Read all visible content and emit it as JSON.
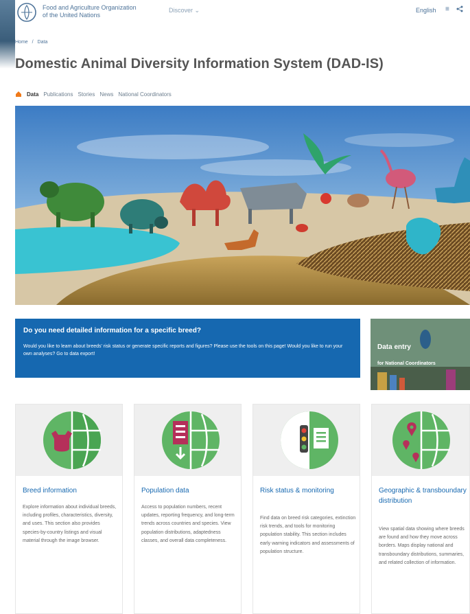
{
  "header": {
    "org_name_line1": "Food and Agriculture Organization",
    "org_name_line2": "of the United Nations",
    "discover_label": "Discover",
    "language_label": "English",
    "icons": [
      "fao-logo",
      "menu-icon",
      "share-icon"
    ]
  },
  "breadcrumb": {
    "home": "Home",
    "separator": "/",
    "current": "Data"
  },
  "page_title": "Domestic Animal Diversity Information System (DAD-IS)",
  "subnav": {
    "items": [
      "Data",
      "Publications",
      "Stories",
      "News",
      "National Coordinators"
    ],
    "active_index": 0
  },
  "callout": {
    "heading": "Do you need detailed information for a specific breed?",
    "body": "Would you like to learn about breeds' risk status or generate specific reports and figures? Please use the tools on this page! Would you like to run your own analyses? Go to data export!"
  },
  "data_entry": {
    "title": "Data entry",
    "subtitle": "for National Coordinators"
  },
  "cards": [
    {
      "title": "Breed information",
      "description": "Explore information about individual breeds, including profiles, characteristics, diversity, and uses. This section also provides species-by-country listings and visual material through the image browser."
    },
    {
      "title": "Population data",
      "description": "Access to population numbers, recent updates, reporting frequency, and long-term trends across countries and species. View population distributions, adaptedness classes, and overall data completeness."
    },
    {
      "title": "Risk status & monitoring",
      "description": "Find data on breed risk categories, extinction risk trends, and tools for monitoring population stability. This section includes early warning indicators and assessments of population structure."
    },
    {
      "title": "Geographic & transboundary distribution",
      "description": "View spatial data showing where breeds are found and how they move across borders. Maps display national and transboundary distributions, summaries, and related collection of information."
    }
  ],
  "colors": {
    "brand_blue": "#1668b0",
    "icon_green": "#5fb565",
    "link_blue": "#4d7399"
  }
}
